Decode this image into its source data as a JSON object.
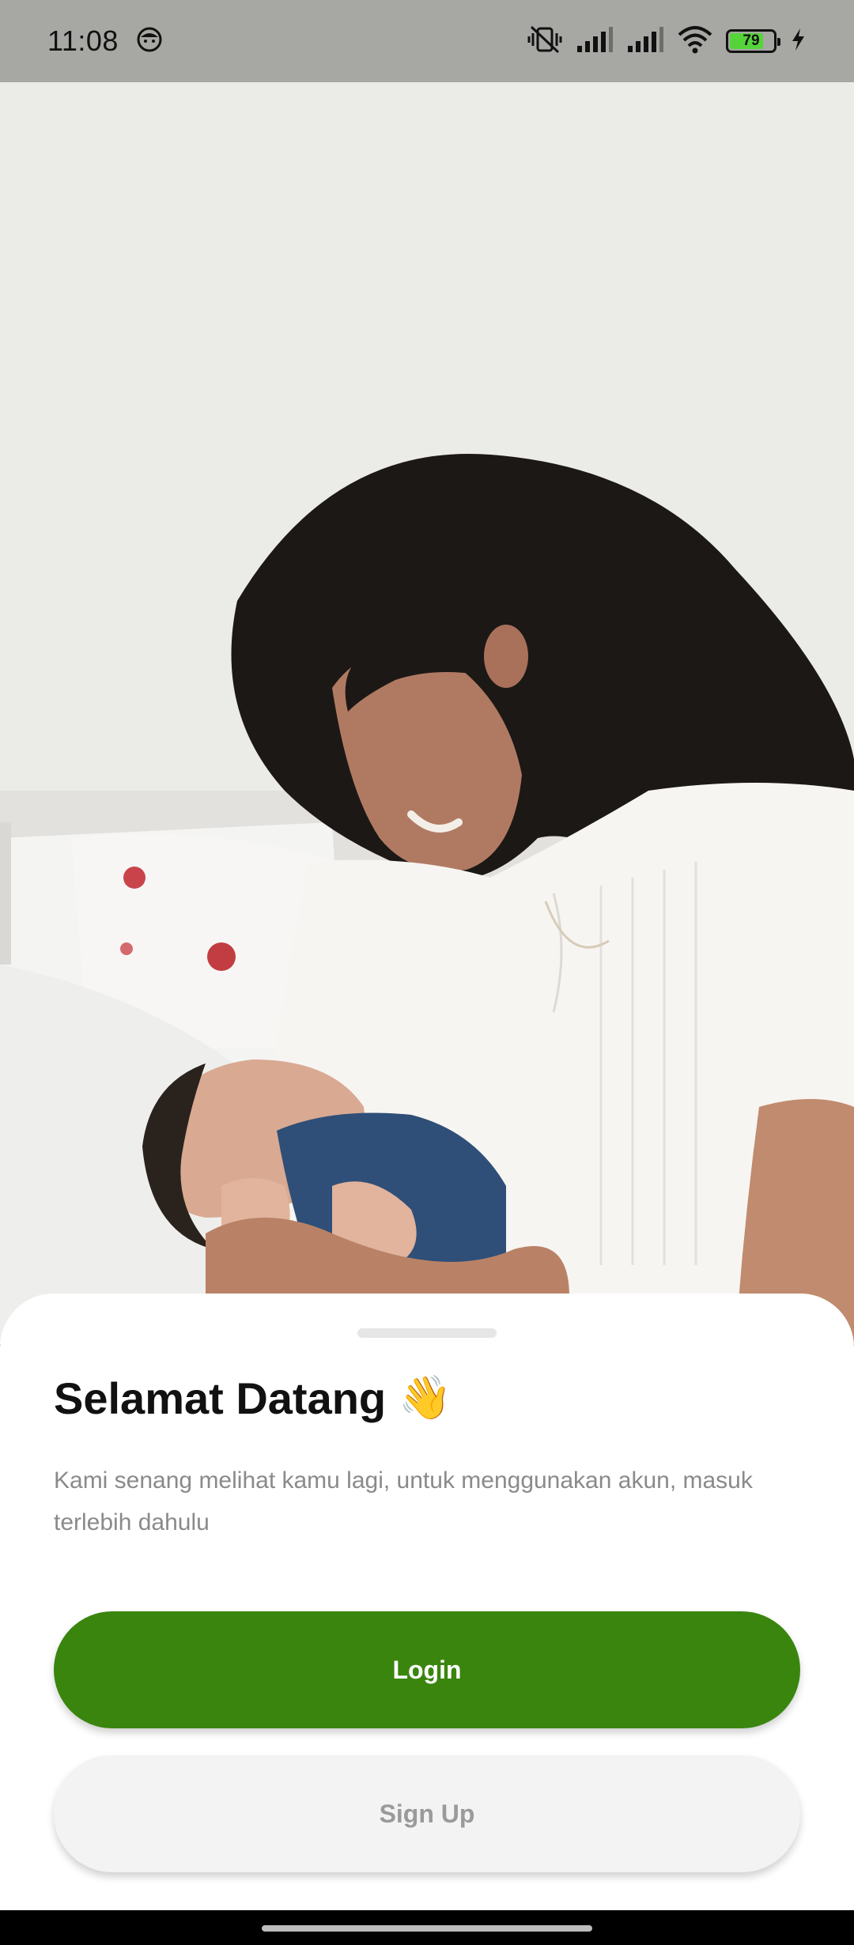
{
  "status_bar": {
    "time": "11:08",
    "battery_level": "79",
    "icons": [
      "face-icon",
      "vibrate-off-icon",
      "signal-icon",
      "signal-icon",
      "wifi-icon",
      "battery-icon",
      "charging-bolt-icon"
    ]
  },
  "hero": {
    "image": "mother-holding-newborn-photo"
  },
  "sheet": {
    "title": "Selamat Datang",
    "title_emoji": "👋",
    "subtitle": "Kami senang melihat kamu lagi, untuk menggunakan akun, masuk terlebih dahulu",
    "login_label": "Login",
    "signup_label": "Sign Up"
  },
  "colors": {
    "primary": "#3a850e",
    "secondary_button": "#f3f3f3",
    "status_bar": "#a7a7a4"
  }
}
